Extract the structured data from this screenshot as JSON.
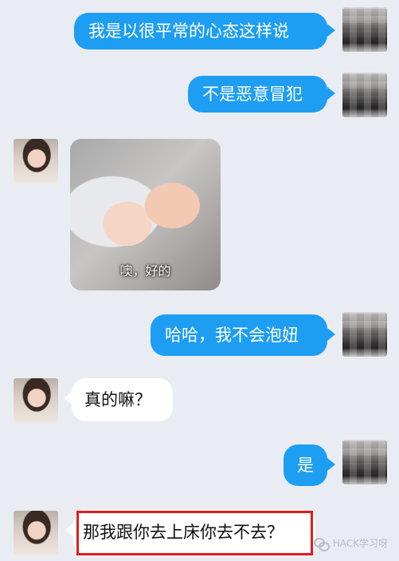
{
  "messages": [
    {
      "side": "right",
      "text": "我是以很平常的心态这样说"
    },
    {
      "side": "right",
      "text": "不是恶意冒犯"
    },
    {
      "side": "left",
      "type": "image",
      "caption": "噢，好的"
    },
    {
      "side": "right",
      "text": "哈哈，我不会泡妞"
    },
    {
      "side": "left",
      "text": "真的嘛？"
    },
    {
      "side": "right",
      "text": "是"
    },
    {
      "side": "left",
      "text": "那我跟你去上床你去不去？"
    }
  ],
  "watermark": {
    "text": "HACK学习呀"
  },
  "colors": {
    "background": "#e9edf3",
    "bubble_right": "#1e9ef2",
    "bubble_left": "#ffffff",
    "highlight": "#e41b1b"
  }
}
